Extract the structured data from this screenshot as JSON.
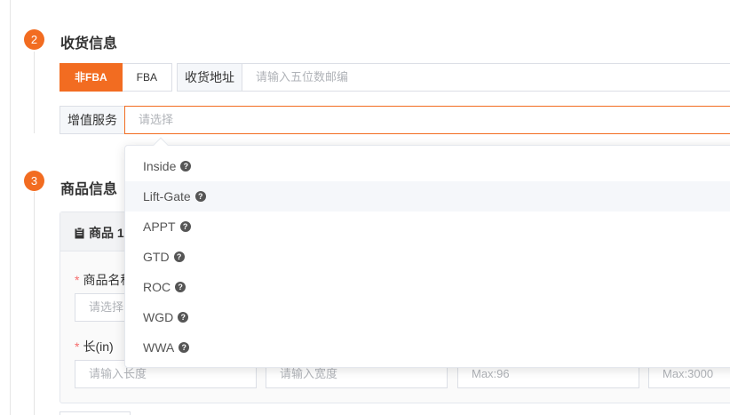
{
  "steps": [
    {
      "number": "2",
      "title": "收货信息"
    },
    {
      "number": "3",
      "title": "商品信息"
    }
  ],
  "shipping": {
    "segments": [
      {
        "label": "非FBA",
        "active": true
      },
      {
        "label": "FBA",
        "active": false
      }
    ],
    "address_label": "收货地址",
    "address_placeholder": "请输入五位数邮编",
    "service_label": "增值服务",
    "service_placeholder": "请选择"
  },
  "dropdown": {
    "options": [
      {
        "label": "Inside",
        "hovered": false
      },
      {
        "label": "Lift-Gate",
        "hovered": true
      },
      {
        "label": "APPT",
        "hovered": false
      },
      {
        "label": "GTD",
        "hovered": false
      },
      {
        "label": "ROC",
        "hovered": false
      },
      {
        "label": "WGD",
        "hovered": false
      },
      {
        "label": "WWA",
        "hovered": false
      }
    ],
    "help_glyph": "?"
  },
  "product": {
    "card_title": "商品 1",
    "name_label": "商品名称",
    "name_placeholder": "请选择",
    "length_label": "长(in)",
    "length_placeholder": "请输入长度",
    "width_placeholder": "请输入宽度",
    "height_placeholder": "Max:96",
    "weight_placeholder": "Max:3000",
    "required_mark": "*"
  },
  "colors": {
    "accent": "#f26c21",
    "required": "#f56c6c"
  }
}
